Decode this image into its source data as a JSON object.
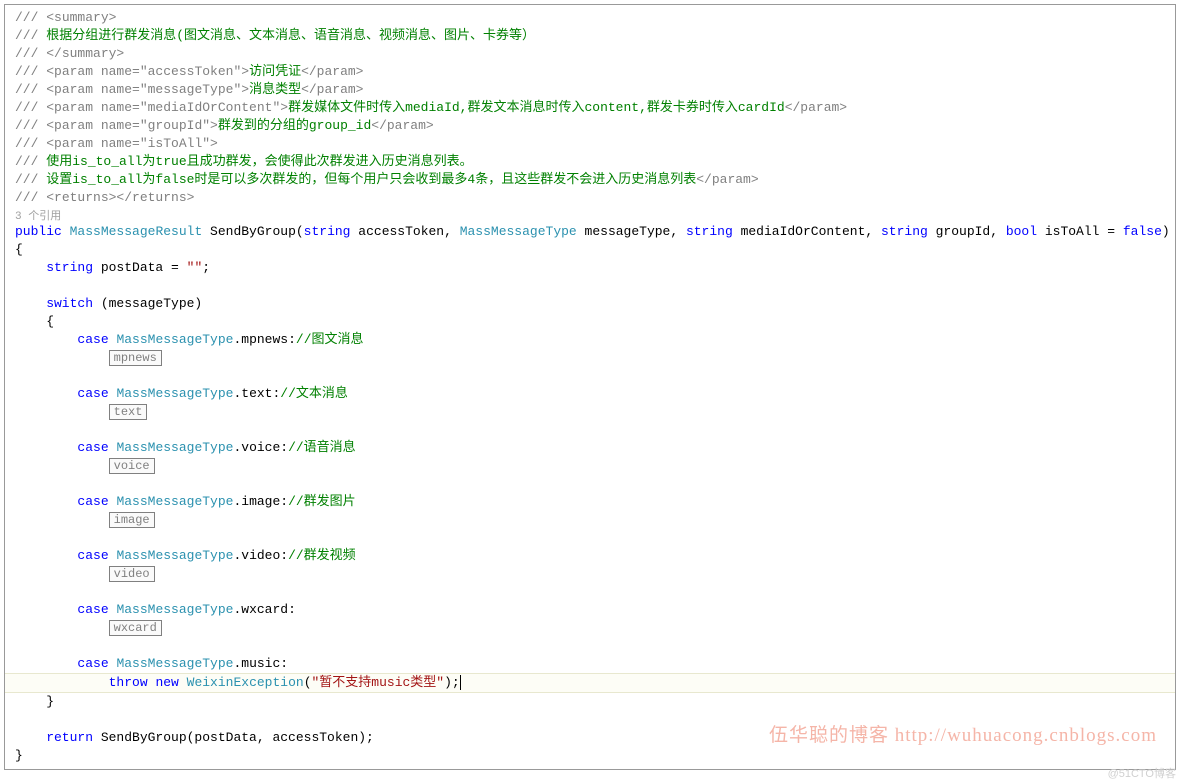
{
  "doc": {
    "l1a": "/// ",
    "l1b": "<summary>",
    "l2a": "/// ",
    "l2b": "根据分组进行群发消息(图文消息、文本消息、语音消息、视频消息、图片、卡券等）",
    "l3a": "/// ",
    "l3b": "</summary>",
    "l4a": "/// ",
    "l4b": "<param name=\"accessToken\">",
    "l4c": "访问凭证",
    "l4d": "</param>",
    "l5a": "/// ",
    "l5b": "<param name=\"messageType\">",
    "l5c": "消息类型",
    "l5d": "</param>",
    "l6a": "/// ",
    "l6b": "<param name=\"mediaIdOrContent\">",
    "l6c": "群发媒体文件时传入mediaId,群发文本消息时传入content,群发卡券时传入cardId",
    "l6d": "</param>",
    "l7a": "/// ",
    "l7b": "<param name=\"groupId\">",
    "l7c": "群发到的分组的group_id",
    "l7d": "</param>",
    "l8a": "/// ",
    "l8b": "<param name=\"isToAll\">",
    "l9a": "/// ",
    "l9b": "使用is_to_all为true且成功群发，会使得此次群发进入历史消息列表。",
    "l10a": "/// ",
    "l10b": "设置is_to_all为false时是可以多次群发的，但每个用户只会收到最多4条，且这些群发不会进入历史消息列表",
    "l10c": "</param>",
    "l11a": "/// ",
    "l11b": "<returns></returns>"
  },
  "codelens": "3 个引用",
  "sig": {
    "public": "public",
    "sp": " ",
    "retType": "MassMessageResult",
    "name": " SendByGroup(",
    "t_string": "string",
    "p1": " accessToken, ",
    "t_mmtype": "MassMessageType",
    "p2": " messageType, ",
    "p3": " mediaIdOrContent, ",
    "p4": " groupId, ",
    "t_bool": "bool",
    "p5": " isToAll = ",
    "false": "false",
    "end": ")"
  },
  "body": {
    "lbrace": "{",
    "l_string": "    string",
    "l_post": " postData = ",
    "l_empty": "\"\"",
    "l_semi": ";",
    "switch": "    switch",
    "switch_arg": " (messageType)",
    "switch_open": "    {",
    "case": "        case",
    "type": "MassMessageType",
    "mpnews": ".mpnews:",
    "mpnews_c": "//图文消息",
    "mpnews_box": "mpnews",
    "text": ".text:",
    "text_c": "//文本消息",
    "text_box": "text",
    "voice": ".voice:",
    "voice_c": "//语音消息",
    "voice_box": "voice",
    "image": ".image:",
    "image_c": "//群发图片",
    "image_box": "image",
    "video": ".video:",
    "video_c": "//群发视频",
    "video_box": "video",
    "wxcard": ".wxcard:",
    "wxcard_box": "wxcard",
    "music": ".music:",
    "throw": "            throw",
    "new": "new",
    "exc": "WeixinException",
    "exc_arg": "(",
    "exc_msg": "\"暂不支持music类型\"",
    "exc_end": ");",
    "switch_close": "    }",
    "return": "    return",
    "return_expr": " SendByGroup(postData, accessToken);",
    "rbrace": "}"
  },
  "watermark": "伍华聪的博客 http://wuhuacong.cnblogs.com",
  "footer": "@51CTO博客"
}
